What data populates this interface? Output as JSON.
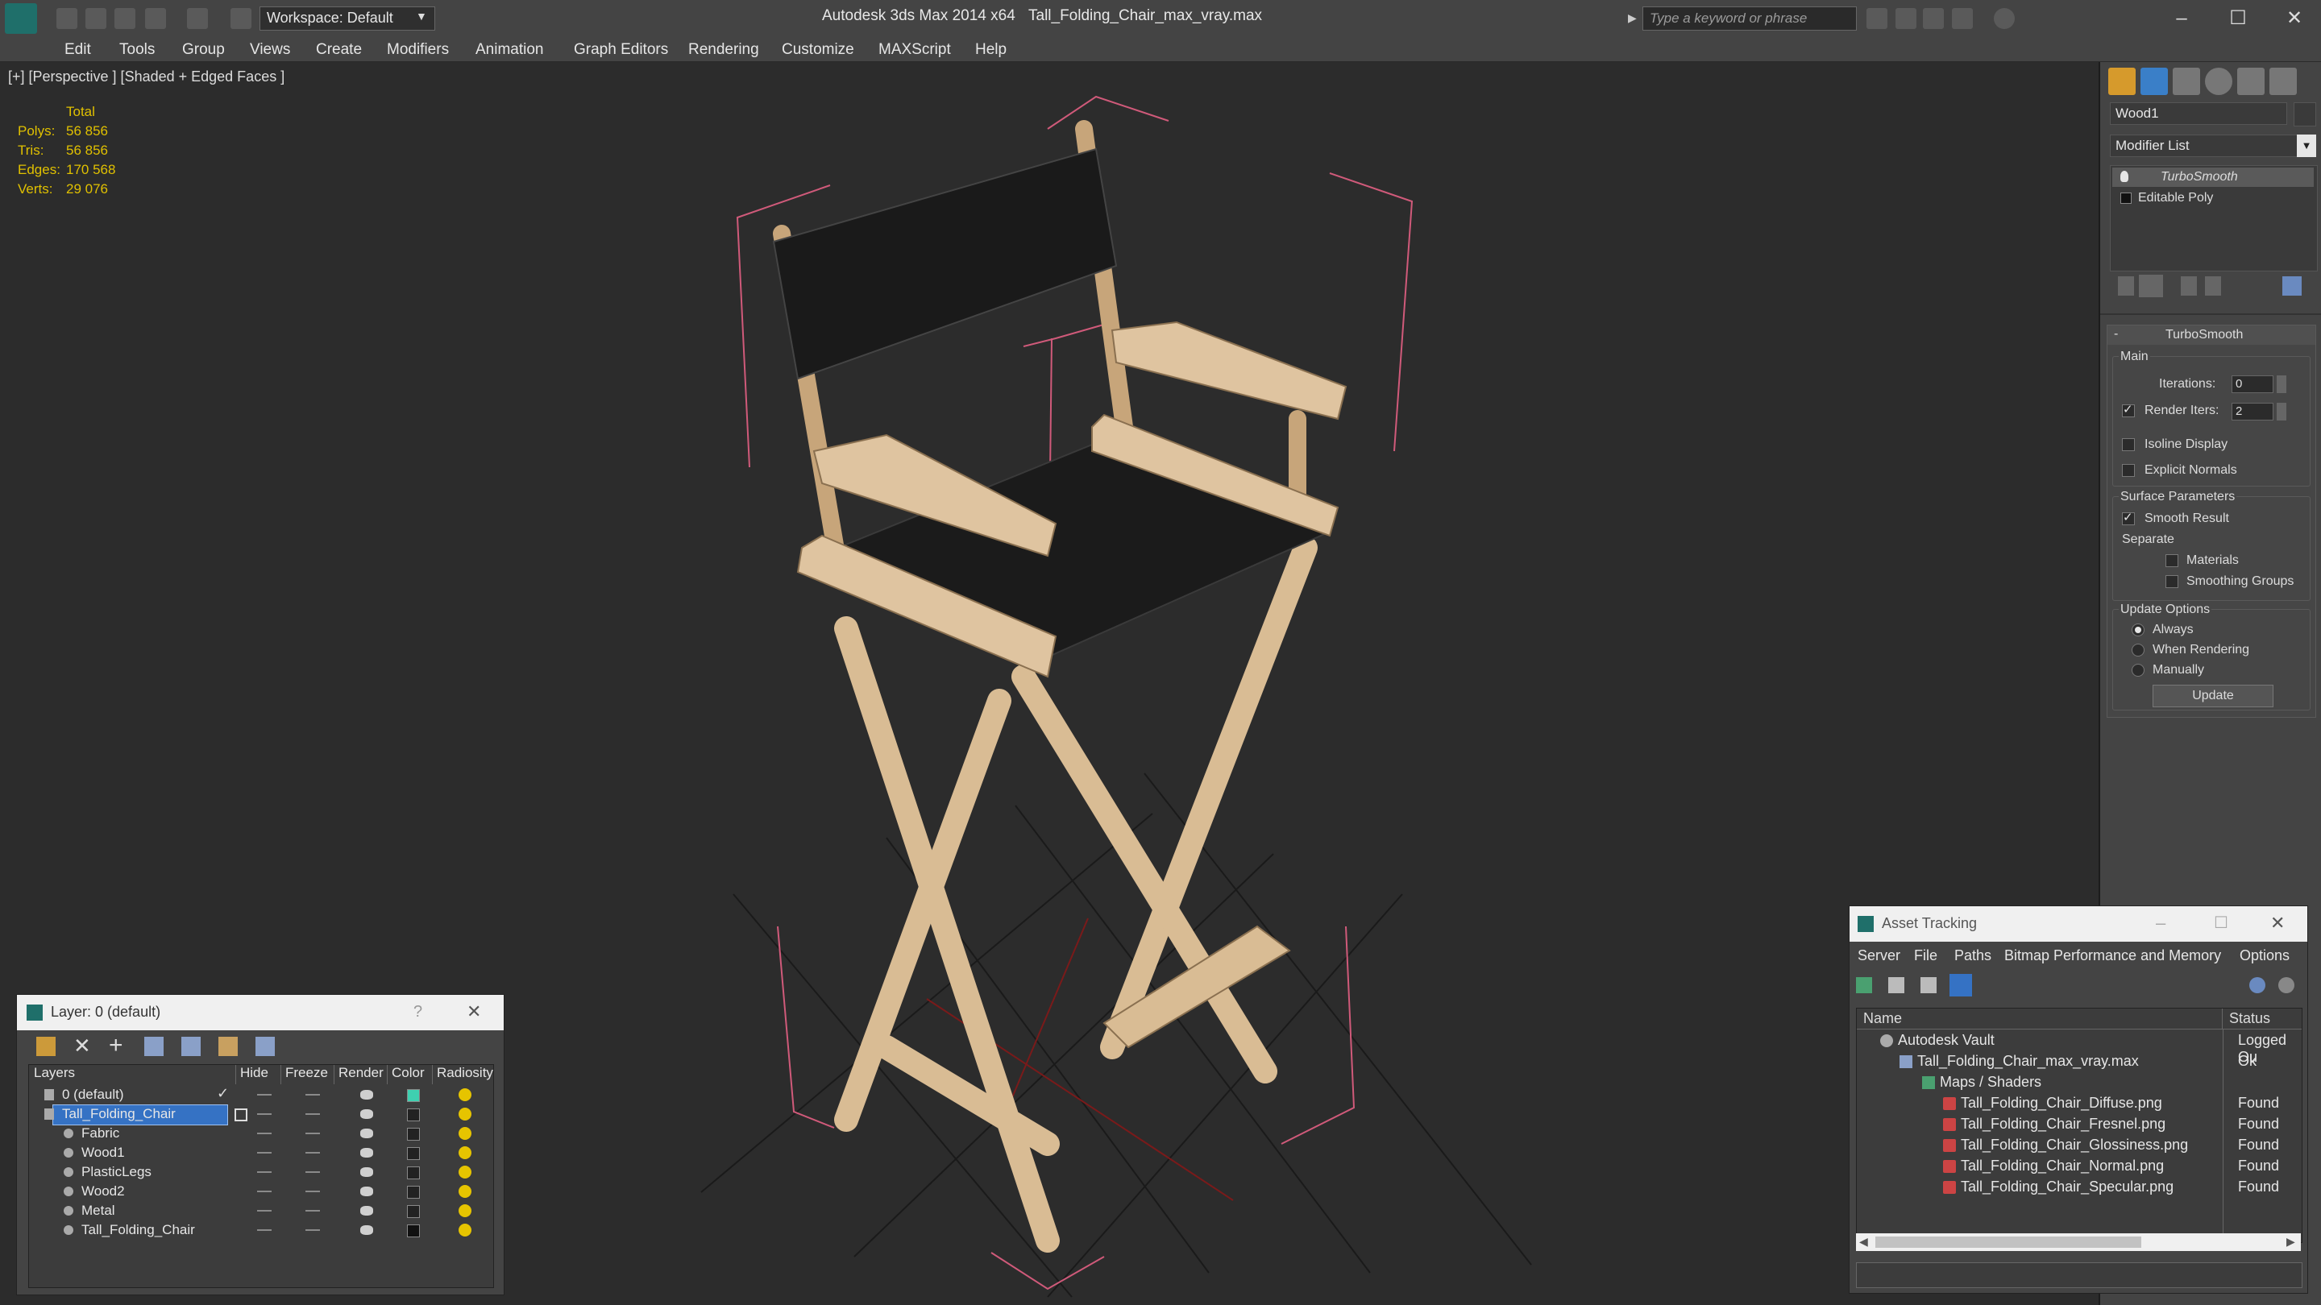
{
  "titlebar": {
    "workspace": "Workspace: Default",
    "app_title": "Autodesk 3ds Max  2014 x64",
    "file_title": "Tall_Folding_Chair_max_vray.max",
    "search_placeholder": "Type a keyword or phrase"
  },
  "menu": [
    "Edit",
    "Tools",
    "Group",
    "Views",
    "Create",
    "Modifiers",
    "Animation",
    "Graph Editors",
    "Rendering",
    "Customize",
    "MAXScript",
    "Help"
  ],
  "viewport": {
    "label": "[+] [Perspective ] [Shaded + Edged Faces ]",
    "stats": {
      "header": "Total",
      "rows": [
        {
          "label": "Polys:",
          "value": "56 856"
        },
        {
          "label": "Tris:",
          "value": "56 856"
        },
        {
          "label": "Edges:",
          "value": "170 568"
        },
        {
          "label": "Verts:",
          "value": "29 076"
        }
      ]
    }
  },
  "command_panel": {
    "object_name": "Wood1",
    "modifier_list": "Modifier List",
    "stack": [
      "TurboSmooth",
      "Editable Poly"
    ],
    "rollout_title": "TurboSmooth",
    "main_label": "Main",
    "iterations_label": "Iterations:",
    "iterations_value": "0",
    "render_iters_label": "Render Iters:",
    "render_iters_value": "2",
    "isoline_label": "Isoline Display",
    "explicit_normals_label": "Explicit Normals",
    "surface_params_label": "Surface Parameters",
    "smooth_result_label": "Smooth Result",
    "separate_label": "Separate",
    "materials_label": "Materials",
    "smoothing_groups_label": "Smoothing Groups",
    "update_options_label": "Update Options",
    "always_label": "Always",
    "when_rendering_label": "When Rendering",
    "manually_label": "Manually",
    "update_button": "Update"
  },
  "layer_window": {
    "title": "Layer: 0 (default)",
    "help": "?",
    "columns": [
      "Layers",
      "Hide",
      "Freeze",
      "Render",
      "Color",
      "Radiosity"
    ],
    "rows": [
      {
        "name": "0 (default)",
        "color": "#3fd0b0"
      },
      {
        "name": "Tall_Folding_Chair",
        "color": "#222222"
      },
      {
        "name": "Fabric",
        "color": "#222222"
      },
      {
        "name": "Wood1",
        "color": "#222222"
      },
      {
        "name": "PlasticLegs",
        "color": "#222222"
      },
      {
        "name": "Wood2",
        "color": "#222222"
      },
      {
        "name": "Metal",
        "color": "#222222"
      },
      {
        "name": "Tall_Folding_Chair",
        "color": "#111111"
      }
    ]
  },
  "asset_window": {
    "title": "Asset Tracking",
    "menu": [
      "Server",
      "File",
      "Paths",
      "Bitmap Performance and Memory",
      "Options"
    ],
    "columns": [
      "Name",
      "Status"
    ],
    "rows": [
      {
        "name": "Autodesk Vault",
        "status": "Logged Ou"
      },
      {
        "name": "Tall_Folding_Chair_max_vray.max",
        "status": "Ok"
      },
      {
        "name": "Maps / Shaders",
        "status": ""
      },
      {
        "name": "Tall_Folding_Chair_Diffuse.png",
        "status": "Found"
      },
      {
        "name": "Tall_Folding_Chair_Fresnel.png",
        "status": "Found"
      },
      {
        "name": "Tall_Folding_Chair_Glossiness.png",
        "status": "Found"
      },
      {
        "name": "Tall_Folding_Chair_Normal.png",
        "status": "Found"
      },
      {
        "name": "Tall_Folding_Chair_Specular.png",
        "status": "Found"
      }
    ]
  }
}
